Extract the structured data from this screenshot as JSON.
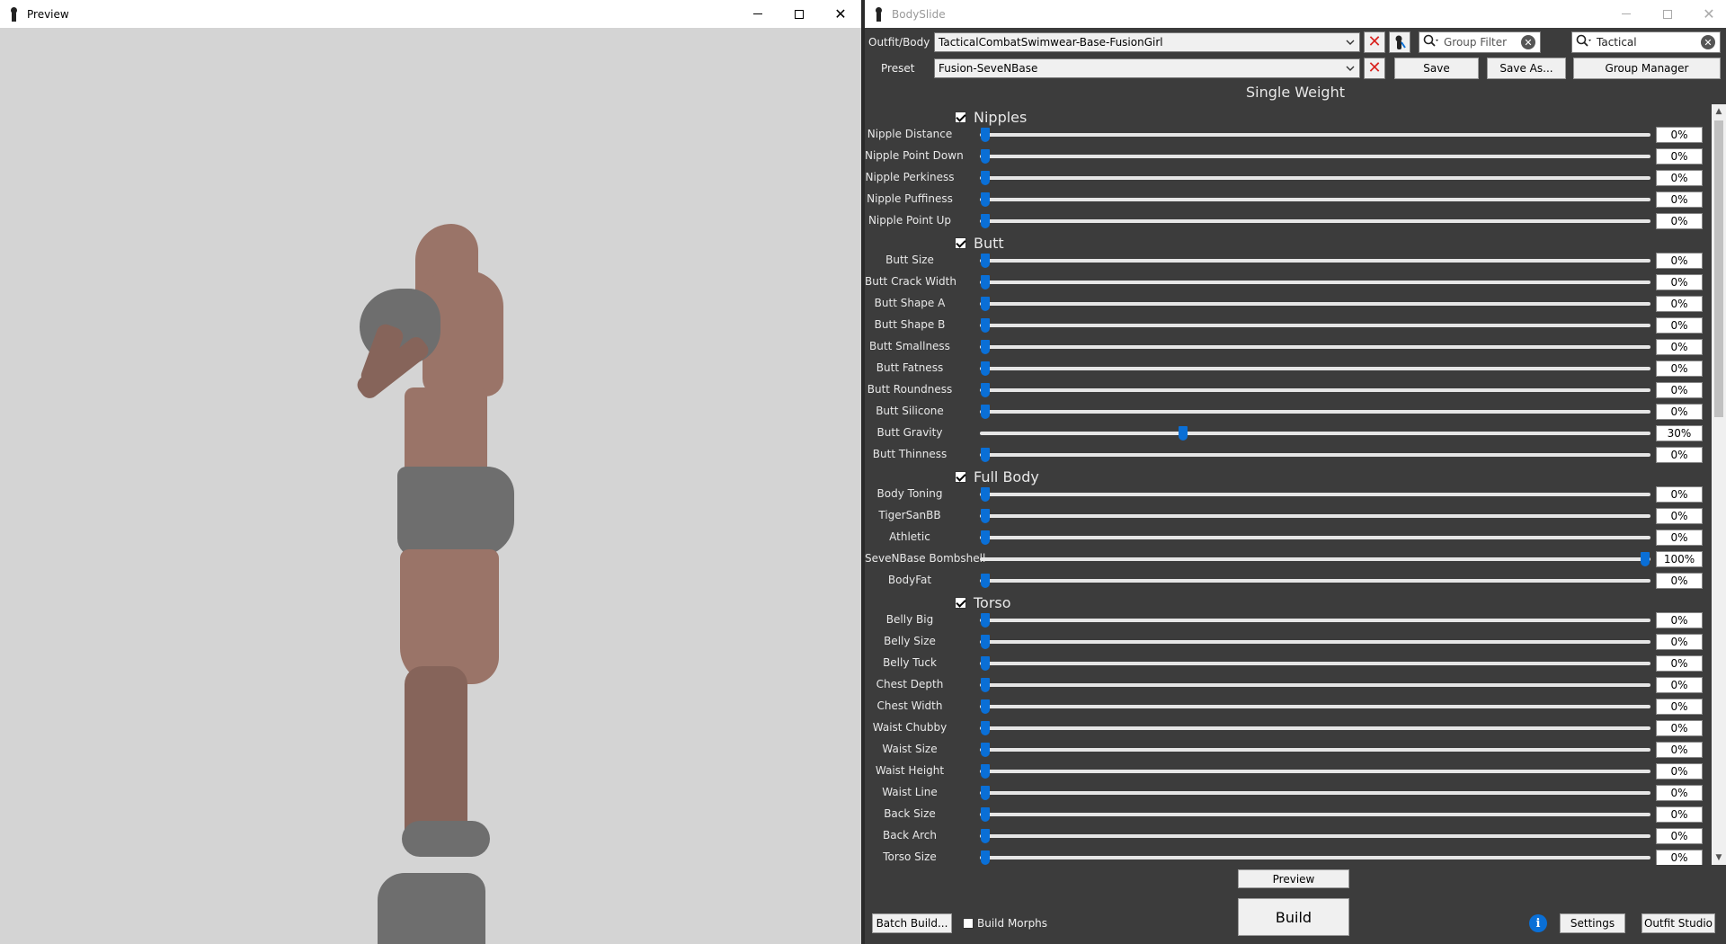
{
  "preview": {
    "title": "Preview"
  },
  "bodyslide": {
    "title": "BodySlide",
    "outfit_label": "Outfit/Body",
    "outfit_value": "TacticalCombatSwimwear-Base-FusionGirl",
    "preset_label": "Preset",
    "preset_value": "Fusion-SeveNBase",
    "group_filter_placeholder": "Group Filter",
    "outfit_filter_value": "Tactical",
    "save_label": "Save",
    "save_as_label": "Save As...",
    "group_manager_label": "Group Manager",
    "mode_title": "Single Weight",
    "categories": [
      {
        "name": "Nipples",
        "sliders": [
          {
            "label": "Nipple Distance",
            "value": 0,
            "display": "0%"
          },
          {
            "label": "Nipple Point Down",
            "value": 0,
            "display": "0%"
          },
          {
            "label": "Nipple Perkiness",
            "value": 0,
            "display": "0%"
          },
          {
            "label": "Nipple Puffiness",
            "value": 0,
            "display": "0%"
          },
          {
            "label": "Nipple Point Up",
            "value": 0,
            "display": "0%"
          }
        ]
      },
      {
        "name": "Butt",
        "sliders": [
          {
            "label": "Butt Size",
            "value": 0,
            "display": "0%"
          },
          {
            "label": "Butt Crack Width",
            "value": 0,
            "display": "0%"
          },
          {
            "label": "Butt Shape A",
            "value": 0,
            "display": "0%"
          },
          {
            "label": "Butt Shape B",
            "value": 0,
            "display": "0%"
          },
          {
            "label": "Butt Smallness",
            "value": 0,
            "display": "0%"
          },
          {
            "label": "Butt Fatness",
            "value": 0,
            "display": "0%"
          },
          {
            "label": "Butt Roundness",
            "value": 0,
            "display": "0%"
          },
          {
            "label": "Butt Silicone",
            "value": 0,
            "display": "0%"
          },
          {
            "label": "Butt Gravity",
            "value": 30,
            "display": "30%"
          },
          {
            "label": "Butt Thinness",
            "value": 0,
            "display": "0%"
          }
        ]
      },
      {
        "name": "Full Body",
        "sliders": [
          {
            "label": "Body Toning",
            "value": 0,
            "display": "0%"
          },
          {
            "label": "TigerSanBB",
            "value": 0,
            "display": "0%"
          },
          {
            "label": "Athletic",
            "value": 0,
            "display": "0%"
          },
          {
            "label": "SeveNBase Bombshell",
            "value": 100,
            "display": "100%"
          },
          {
            "label": "BodyFat",
            "value": 0,
            "display": "0%"
          }
        ]
      },
      {
        "name": "Torso",
        "sliders": [
          {
            "label": "Belly Big",
            "value": 0,
            "display": "0%"
          },
          {
            "label": "Belly Size",
            "value": 0,
            "display": "0%"
          },
          {
            "label": "Belly Tuck",
            "value": 0,
            "display": "0%"
          },
          {
            "label": "Chest Depth",
            "value": 0,
            "display": "0%"
          },
          {
            "label": "Chest Width",
            "value": 0,
            "display": "0%"
          },
          {
            "label": "Waist Chubby",
            "value": 0,
            "display": "0%"
          },
          {
            "label": "Waist Size",
            "value": 0,
            "display": "0%"
          },
          {
            "label": "Waist Height",
            "value": 0,
            "display": "0%"
          },
          {
            "label": "Waist Line",
            "value": 0,
            "display": "0%"
          },
          {
            "label": "Back Size",
            "value": 0,
            "display": "0%"
          },
          {
            "label": "Back Arch",
            "value": 0,
            "display": "0%"
          },
          {
            "label": "Torso Size",
            "value": 0,
            "display": "0%"
          }
        ]
      }
    ],
    "preview_button_label": "Preview",
    "build_button_label": "Build",
    "batch_build_label": "Batch Build...",
    "build_morphs_label": "Build Morphs",
    "settings_label": "Settings",
    "outfit_studio_label": "Outfit Studio",
    "colors": {
      "accent": "#0a6fd6",
      "clear_red": "#d9231f",
      "panel_bg": "#3c3c3c"
    }
  }
}
